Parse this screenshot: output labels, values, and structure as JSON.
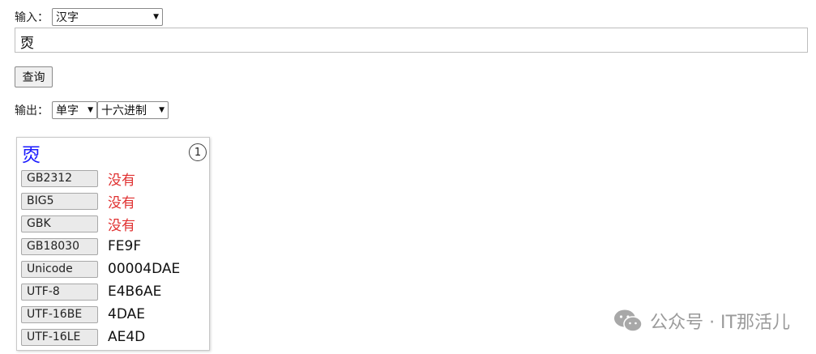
{
  "input_row": {
    "label": "输入：",
    "select_value": "汉字"
  },
  "textbox": {
    "value": "㶮"
  },
  "query_button": {
    "label": "查询"
  },
  "output_row": {
    "label": "输出：",
    "mode_value": "单字",
    "format_value": "十六进制"
  },
  "result_card": {
    "char": "㶮",
    "index": "1",
    "encodings": [
      {
        "label": "GB2312",
        "value": "没有",
        "missing": true
      },
      {
        "label": "BIG5",
        "value": "没有",
        "missing": true
      },
      {
        "label": "GBK",
        "value": "没有",
        "missing": true
      },
      {
        "label": "GB18030",
        "value": "FE9F",
        "missing": false
      },
      {
        "label": "Unicode",
        "value": "00004DAE",
        "missing": false
      },
      {
        "label": "UTF-8",
        "value": "E4B6AE",
        "missing": false
      },
      {
        "label": "UTF-16BE",
        "value": "4DAE",
        "missing": false
      },
      {
        "label": "UTF-16LE",
        "value": "AE4D",
        "missing": false
      }
    ]
  },
  "watermark": {
    "text": "公众号 · IT那活儿",
    "icon": "wechat-icon"
  },
  "colors": {
    "char": "#1a1aff",
    "missing": "#e03030"
  }
}
